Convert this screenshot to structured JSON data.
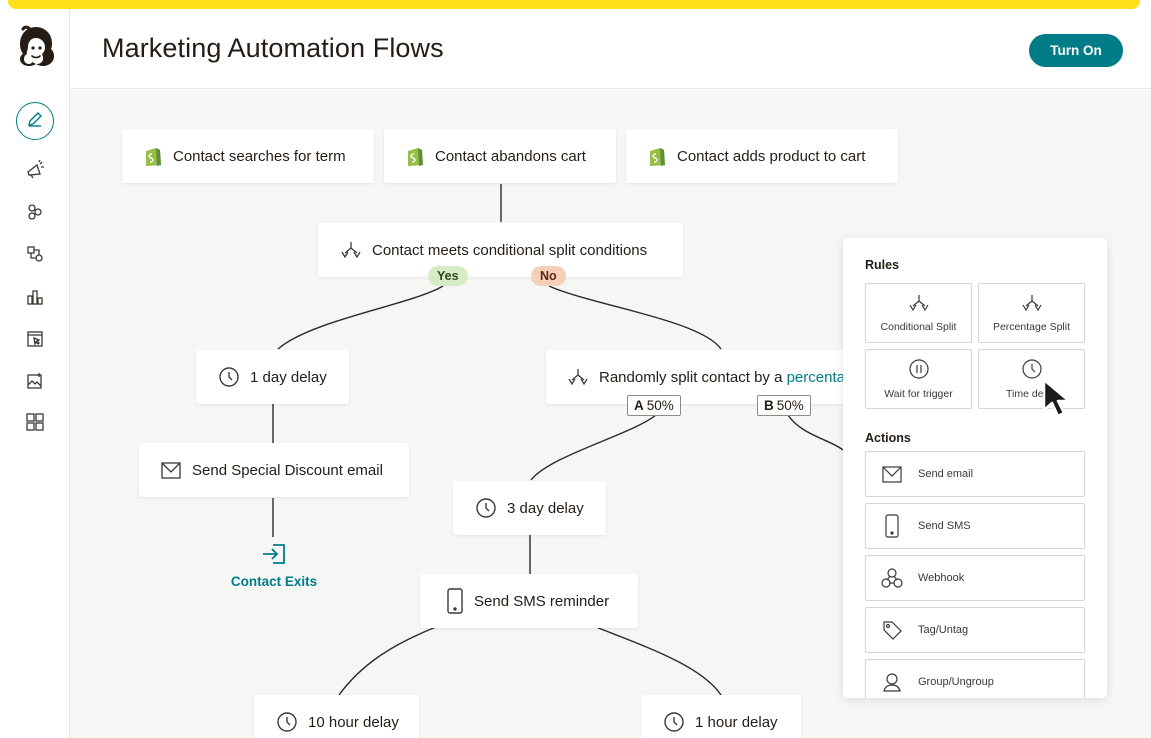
{
  "app": {
    "title": "Marketing Automation Flows",
    "turn_on_label": "Turn On",
    "accent": "#007c89",
    "brand_yellow": "#ffe01b"
  },
  "sidebar": {
    "logo": "mailchimp-freddie-logo",
    "items": [
      {
        "icon": "pencil-icon",
        "active": true
      },
      {
        "icon": "megaphone-icon"
      },
      {
        "icon": "audience-icon"
      },
      {
        "icon": "automations-icon"
      },
      {
        "icon": "analytics-icon"
      },
      {
        "icon": "website-icon"
      },
      {
        "icon": "content-icon"
      },
      {
        "icon": "integrations-icon"
      }
    ]
  },
  "flow": {
    "triggers": [
      {
        "label": "Contact searches for term",
        "icon": "shopify-icon"
      },
      {
        "label": "Contact abandons cart",
        "icon": "shopify-icon"
      },
      {
        "label": "Contact adds product to cart",
        "icon": "shopify-icon"
      }
    ],
    "conditional_split": {
      "label": "Contact meets conditional split conditions",
      "yes": "Yes",
      "no": "No"
    },
    "delay_1day": "1 day delay",
    "random_split": {
      "label_prefix": "Randomly split contact by a ",
      "label_link": "percentage",
      "branch_a_letter": "A",
      "branch_a_value": "50%",
      "branch_b_letter": "B",
      "branch_b_value": "50%"
    },
    "send_discount": "Send Special Discount email",
    "contact_exits": "Contact Exits",
    "delay_3day": "3 day delay",
    "send_sms": "Send SMS reminder",
    "delay_10hour": "10 hour delay",
    "delay_1hour": "1 hour delay"
  },
  "panel": {
    "rules_heading": "Rules",
    "rules": [
      {
        "label": "Conditional Split",
        "icon": "split-icon"
      },
      {
        "label": "Percentage Split",
        "icon": "split-icon"
      },
      {
        "label": "Wait for trigger",
        "icon": "pause-icon"
      },
      {
        "label": "Time delay",
        "icon": "clock-icon"
      }
    ],
    "actions_heading": "Actions",
    "actions": [
      {
        "label": "Send email",
        "icon": "mail-icon"
      },
      {
        "label": "Send SMS",
        "icon": "phone-icon"
      },
      {
        "label": "Webhook",
        "icon": "webhook-icon"
      },
      {
        "label": "Tag/Untag",
        "icon": "tag-icon"
      },
      {
        "label": "Group/Ungroup",
        "icon": "group-icon"
      }
    ]
  }
}
